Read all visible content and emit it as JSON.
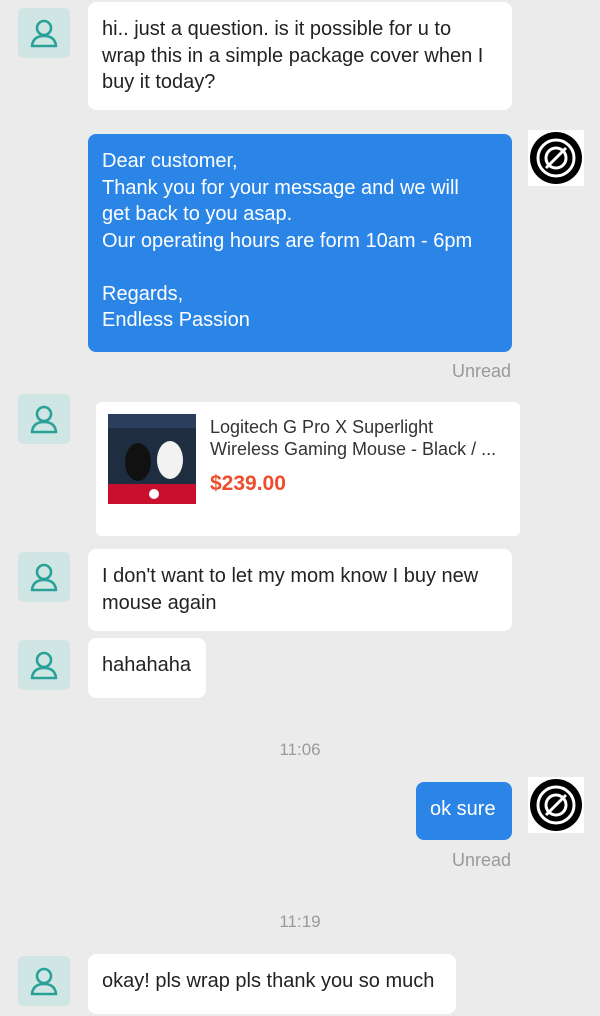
{
  "messages": [
    {
      "text": "hi.. just a question. is it possible for u to\nwrap this in a simple package cover when I\nbuy it today?"
    },
    {
      "text": "Dear customer,\nThank you for your message and we will\nget back to you asap.\nOur operating hours are form 10am - 6pm\n\nRegards,\nEndless Passion",
      "status": "Unread"
    },
    {
      "product": {
        "name": "Logitech G Pro X Superlight Wireless Gaming Mouse - Black / ...",
        "price": "$239.00"
      }
    },
    {
      "text": "I don't want to let my mom know I buy new\nmouse again"
    },
    {
      "text": "hahahaha"
    },
    {
      "timestamp": "11:06"
    },
    {
      "text": "ok sure",
      "status": "Unread"
    },
    {
      "timestamp": "11:19"
    },
    {
      "text": "okay! pls wrap pls thank you so much"
    }
  ],
  "colors": {
    "background": "#ebebeb",
    "outgoing_bubble": "#2a85e6",
    "incoming_bubble": "#ffffff",
    "avatar_bg": "#cfe6e5",
    "avatar_icon": "#2aa197",
    "price": "#ee4d2d",
    "status": "#9a9a9a"
  },
  "icons": {
    "user_avatar": "person-outline-icon",
    "shop_avatar": "circle-logo-icon"
  }
}
